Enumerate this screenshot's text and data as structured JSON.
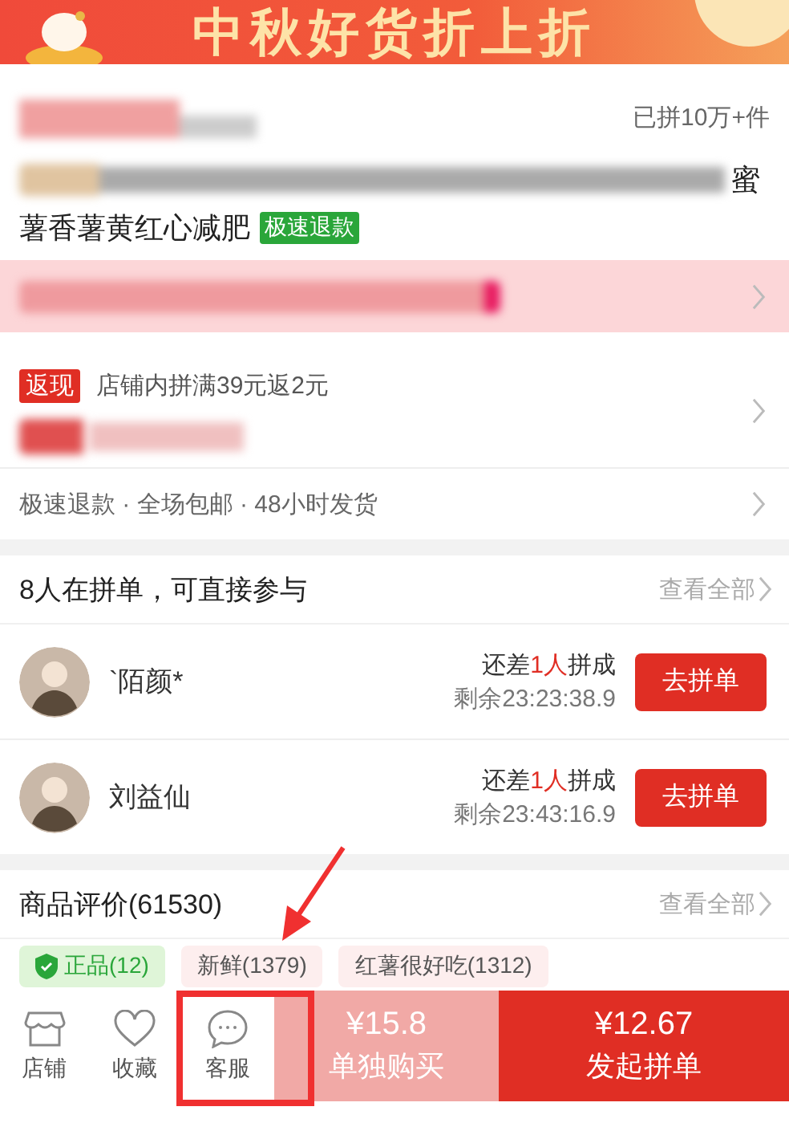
{
  "banner": {
    "title": "中秋好货折上折"
  },
  "product": {
    "sold": "已拼10万+件",
    "title_tail": "蜜",
    "title_line2": "薯香薯黄红心减肥",
    "badge": "极速退款"
  },
  "cashback": {
    "tag": "返现",
    "text": "店铺内拼满39元返2元"
  },
  "services": {
    "text": "极速退款 · 全场包邮 · 48小时发货"
  },
  "group": {
    "title": "8人在拼单，可直接参与",
    "view_all": "查看全部",
    "orders": [
      {
        "name": "`陌颜*",
        "status_before": "还差",
        "status_count": "1人",
        "status_after": "拼成",
        "remaining": "剩余23:23:38.9",
        "button": "去拼单"
      },
      {
        "name": "刘益仙",
        "status_before": "还差",
        "status_count": "1人",
        "status_after": "拼成",
        "remaining": "剩余23:43:16.9",
        "button": "去拼单"
      }
    ]
  },
  "reviews": {
    "title": "商品评价(61530)",
    "view_all": "查看全部",
    "tags": [
      {
        "label": "正品(12)",
        "kind": "verified"
      },
      {
        "label": "新鲜(1379)",
        "kind": "plain"
      },
      {
        "label": "红薯很好吃(1312)",
        "kind": "plain"
      }
    ]
  },
  "bottom_bar": {
    "items": [
      {
        "label": "店铺",
        "kind": "store"
      },
      {
        "label": "收藏",
        "kind": "heart"
      },
      {
        "label": "客服",
        "kind": "chat"
      }
    ],
    "buy_alone": {
      "price": "¥15.8",
      "label": "单独购买"
    },
    "group_buy": {
      "price": "¥12.67",
      "label": "发起拼单"
    }
  }
}
